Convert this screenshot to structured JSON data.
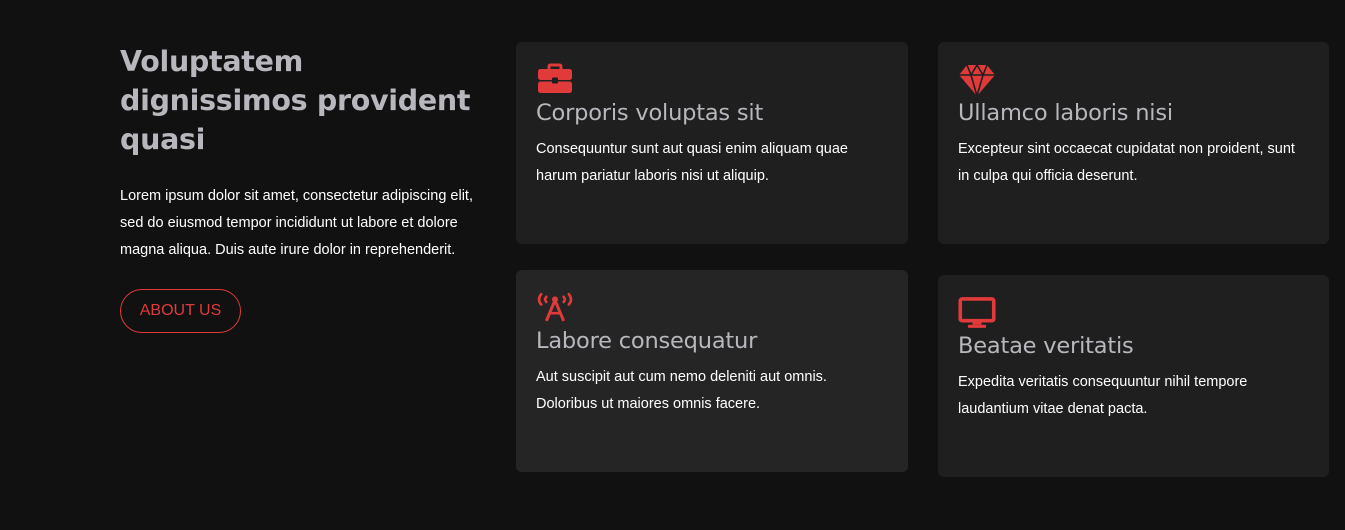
{
  "intro": {
    "title": "Voluptatem dignissimos provident quasi",
    "text": "Lorem ipsum dolor sit amet, consectetur adipiscing elit, sed do eiusmod tempor incididunt ut labore et dolore magna aliqua. Duis aute irure dolor in reprehenderit.",
    "button_label": "ABOUT US"
  },
  "accent_color": "#e03a3a",
  "cards": [
    {
      "icon": "briefcase-icon",
      "title": "Corporis voluptas sit",
      "text": "Consequuntur sunt aut quasi enim aliquam quae harum pariatur laboris nisi ut aliquip."
    },
    {
      "icon": "gem-icon",
      "title": "Ullamco laboris nisi",
      "text": "Excepteur sint occaecat cupidatat non proident, sunt in culpa qui officia deserunt."
    },
    {
      "icon": "broadcast-tower-icon",
      "title": "Labore consequatur",
      "text": "Aut suscipit aut cum nemo deleniti aut omnis. Doloribus ut maiores omnis facere."
    },
    {
      "icon": "monitor-icon",
      "title": "Beatae veritatis",
      "text": "Expedita veritatis consequuntur nihil tempore laudantium vitae denat pacta."
    }
  ]
}
